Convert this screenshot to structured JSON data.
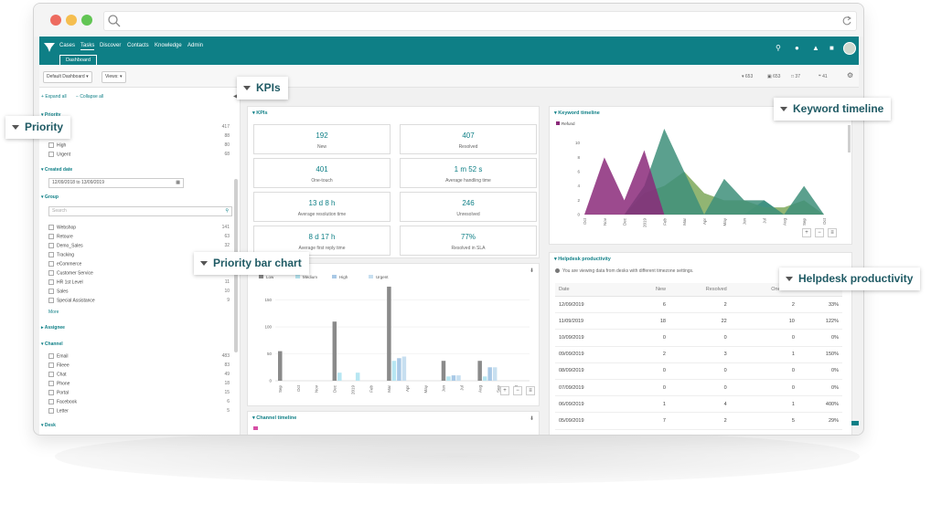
{
  "nav": {
    "items": [
      "Cases",
      "Tasks",
      "Discover",
      "Contacts",
      "Knowledge",
      "Admin"
    ],
    "active": "Tasks",
    "tab": "Dashboard"
  },
  "toolbar": {
    "dashboard_select": "Default Dashboard",
    "views_select": "Views:",
    "stats": [
      "653",
      "653",
      "37",
      "41"
    ]
  },
  "sidebar": {
    "expand_all": "Expand all",
    "collapse_all": "Collapse all",
    "priority": {
      "label": "Priority",
      "counts": [
        "417",
        "88",
        "80",
        "68"
      ],
      "items": [
        "High",
        "Urgent"
      ]
    },
    "created_date": {
      "label": "Created date",
      "value": "12/09/2018 to 13/09/2019"
    },
    "group": {
      "label": "Group",
      "search_placeholder": "Search",
      "more": "More",
      "items": [
        {
          "label": "Webshop",
          "count": "141"
        },
        {
          "label": "Retoure",
          "count": "63"
        },
        {
          "label": "Demo_Sales",
          "count": "32"
        },
        {
          "label": "Tracking",
          "count": "25"
        },
        {
          "label": "eCommerce",
          "count": "21"
        },
        {
          "label": "Customer Service",
          "count": "20"
        },
        {
          "label": "HR 1st Level",
          "count": "11"
        },
        {
          "label": "Sales",
          "count": "10"
        },
        {
          "label": "Special Assistance",
          "count": "9"
        }
      ]
    },
    "assignee": {
      "label": "Assignee"
    },
    "channel": {
      "label": "Channel",
      "items": [
        {
          "label": "Email",
          "count": "483"
        },
        {
          "label": "Fileee",
          "count": "83"
        },
        {
          "label": "Chat",
          "count": "49"
        },
        {
          "label": "Phone",
          "count": "18"
        },
        {
          "label": "Portal",
          "count": "15"
        },
        {
          "label": "Facebook",
          "count": "6"
        },
        {
          "label": "Letter",
          "count": "5"
        }
      ]
    },
    "desk": {
      "label": "Desk"
    }
  },
  "kpis": {
    "title": "KPIs",
    "items": [
      {
        "value": "192",
        "label": "New"
      },
      {
        "value": "407",
        "label": "Resolved"
      },
      {
        "value": "401",
        "label": "One-touch"
      },
      {
        "value": "1 m 52 s",
        "label": "Average handling time"
      },
      {
        "value": "13 d 8 h",
        "label": "Average resolution time"
      },
      {
        "value": "246",
        "label": "Unresolved"
      },
      {
        "value": "8 d 17 h",
        "label": "Average first reply time"
      },
      {
        "value": "77%",
        "label": "Resolved in SLA"
      }
    ]
  },
  "keyword_timeline": {
    "title": "Keyword timeline",
    "legend": "Refund"
  },
  "helpdesk": {
    "title": "Helpdesk productivity",
    "note": "You are viewing data from desks with different timezone settings.",
    "columns": [
      "Date",
      "New",
      "Resolved",
      "One-touch",
      ""
    ],
    "rows": [
      [
        "12/09/2019",
        "6",
        "2",
        "2",
        "33%"
      ],
      [
        "11/09/2019",
        "18",
        "22",
        "10",
        "122%"
      ],
      [
        "10/09/2019",
        "0",
        "0",
        "0",
        "0%"
      ],
      [
        "09/09/2019",
        "2",
        "3",
        "1",
        "150%"
      ],
      [
        "08/09/2019",
        "0",
        "0",
        "0",
        "0%"
      ],
      [
        "07/09/2019",
        "0",
        "0",
        "0",
        "0%"
      ],
      [
        "06/09/2019",
        "1",
        "4",
        "1",
        "400%"
      ],
      [
        "05/09/2019",
        "7",
        "2",
        "5",
        "29%"
      ],
      [
        "04/09/2019",
        "2",
        "1",
        "1",
        "50%"
      ],
      [
        "03/09/2019",
        "0",
        "0",
        "0",
        "0%"
      ]
    ]
  },
  "channel_timeline": {
    "title": "Channel timeline"
  },
  "callouts": {
    "kpis": "KPIs",
    "priority": "Priority",
    "keyword": "Keyword timeline",
    "bar": "Priority bar chart",
    "helpdesk": "Helpdesk productivity"
  },
  "colors": {
    "teal": "#0e7f86"
  },
  "chart_data": [
    {
      "type": "bar",
      "categories": [
        "Sep",
        "Oct",
        "Nov",
        "Dec",
        "2019",
        "Feb",
        "Mar",
        "Apr",
        "May",
        "Jun",
        "Jul",
        "Aug",
        "Sep",
        "Oct"
      ],
      "series": [
        {
          "name": "Low",
          "color": "#8a8a8a",
          "values": [
            55,
            0,
            0,
            110,
            0,
            0,
            175,
            0,
            0,
            37,
            0,
            37,
            0,
            0
          ]
        },
        {
          "name": "Medium",
          "color": "#b7e6f2",
          "values": [
            0,
            0,
            0,
            15,
            15,
            0,
            37,
            0,
            0,
            8,
            0,
            8,
            0,
            0
          ]
        },
        {
          "name": "High",
          "color": "#a9c9e6",
          "values": [
            0,
            0,
            0,
            0,
            0,
            0,
            42,
            0,
            0,
            10,
            0,
            25,
            0,
            0
          ]
        },
        {
          "name": "Urgent",
          "color": "#c7dff0",
          "values": [
            0,
            0,
            0,
            0,
            0,
            0,
            45,
            0,
            0,
            10,
            0,
            25,
            0,
            0
          ]
        }
      ],
      "yticks": [
        "0",
        "50",
        "100",
        "150"
      ],
      "ylim": [
        0,
        180
      ]
    },
    {
      "type": "area",
      "x": [
        "Oct",
        "Nov",
        "Dec",
        "2019",
        "Feb",
        "Mar",
        "Apr",
        "May",
        "Jun",
        "Jul",
        "Aug",
        "Sep",
        "Oct"
      ],
      "series": [
        {
          "name": "Refund",
          "color": "#8b2a7a",
          "values": [
            0,
            8,
            2,
            9,
            0,
            0,
            0,
            0,
            0,
            0,
            0,
            0,
            0
          ]
        },
        {
          "name": "",
          "color": "#3e8f7a",
          "values": [
            0,
            0,
            0,
            4,
            12,
            6,
            0,
            5,
            2,
            2,
            0,
            4,
            0
          ]
        },
        {
          "name": "",
          "color": "#7ea85a",
          "values": [
            0,
            0,
            0,
            3,
            4,
            6,
            3,
            2,
            2,
            1,
            1,
            2,
            0
          ]
        },
        {
          "name": "",
          "color": "#2f8aa0",
          "values": [
            0,
            0,
            0,
            0,
            0,
            0,
            0,
            0,
            0,
            2,
            0,
            0,
            0
          ]
        }
      ],
      "yticks": [
        "0",
        "2",
        "4",
        "6",
        "8",
        "10"
      ],
      "ylim": [
        0,
        12
      ]
    }
  ]
}
